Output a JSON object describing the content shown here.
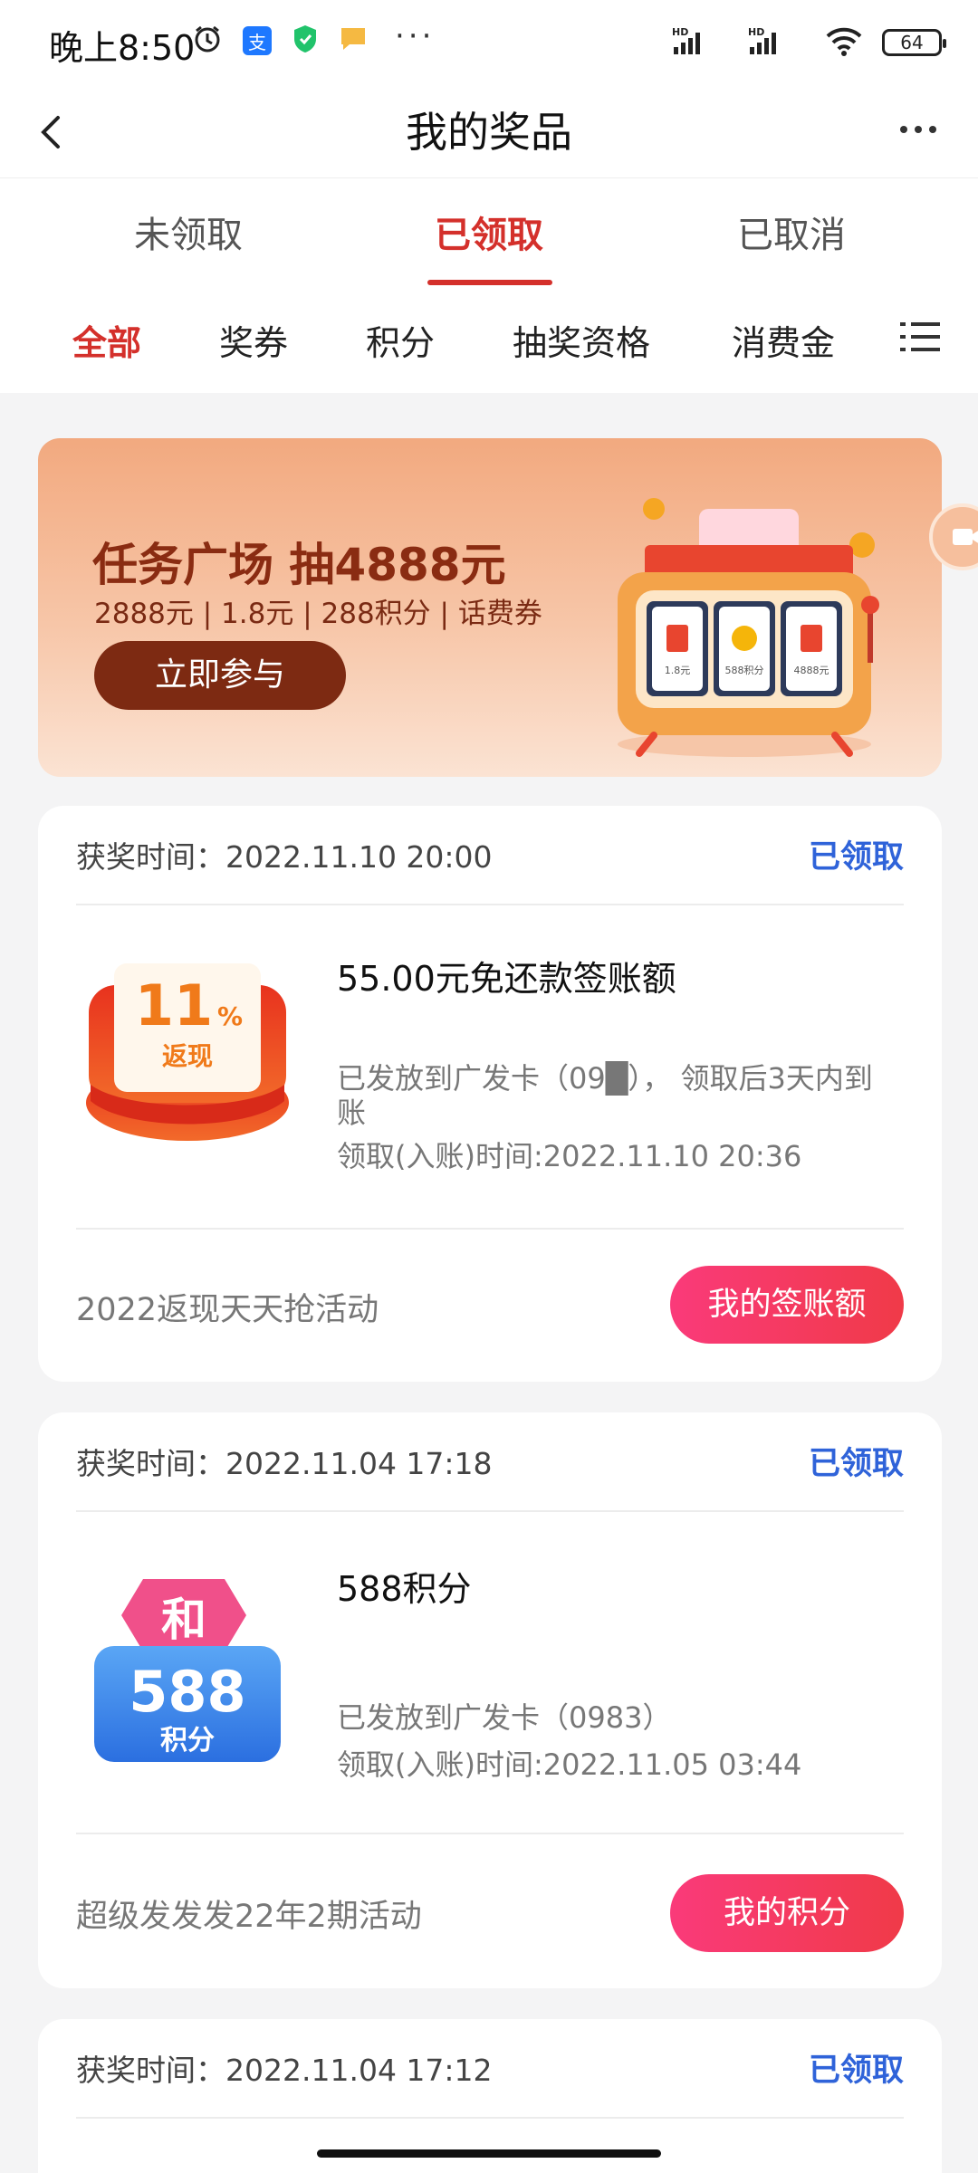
{
  "status_bar": {
    "time": "晚上8:50",
    "signal_label": "HD",
    "battery": "64",
    "icons": [
      "alarm-icon",
      "alipay-icon",
      "shield-icon",
      "message-icon",
      "more-dots-icon",
      "signal-icon",
      "wifi-icon",
      "battery-icon"
    ]
  },
  "header": {
    "title": "我的奖品"
  },
  "main_tabs": [
    {
      "label": "未领取"
    },
    {
      "label": "已领取"
    },
    {
      "label": "已取消"
    }
  ],
  "sub_tabs": [
    {
      "label": "全部"
    },
    {
      "label": "奖券"
    },
    {
      "label": "积分"
    },
    {
      "label": "抽奖资格"
    },
    {
      "label": "消费金"
    }
  ],
  "banner": {
    "title": "任务广场 抽4888元",
    "subtitle": "2888元 | 1.8元 | 288积分 | 话费券",
    "button": "立即参与",
    "slot_labels": [
      "1.8元",
      "588积分",
      "4888元"
    ]
  },
  "cards": [
    {
      "time_label": "获奖时间：2022.11.10 20:00",
      "status": "已领取",
      "prize_name": "55.00元免还款签账额",
      "badge_top": "11",
      "badge_pct": "%",
      "badge_bottom": "返现",
      "desc_line1": "已发放到广发卡（09█）， 领取后3天内到账",
      "desc_line2": "领取(入账)时间:2022.11.10 20:36",
      "activity": "2022返现天天抢活动",
      "button": "我的签账额"
    },
    {
      "time_label": "获奖时间：2022.11.04 17:18",
      "status": "已领取",
      "prize_name": "588积分",
      "badge_top": "和",
      "badge_value": "588",
      "badge_bottom": "积分",
      "desc_line1": "已发放到广发卡（0983）",
      "desc_line2": "领取(入账)时间:2022.11.05 03:44",
      "activity": "超级发发发22年2期活动",
      "button": "我的积分"
    },
    {
      "time_label": "获奖时间：2022.11.04 17:12",
      "status": "已领取"
    }
  ],
  "colors": {
    "accent_red": "#d4302b",
    "status_blue": "#2f63d9",
    "button_pink": "#f53a62",
    "banner_brown": "#7d2a12"
  }
}
